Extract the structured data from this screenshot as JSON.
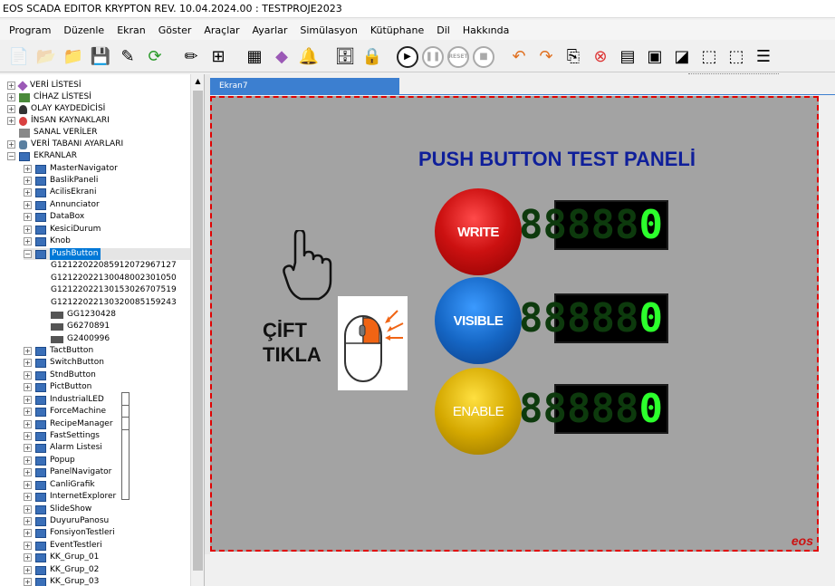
{
  "window": {
    "title": "EOS SCADA EDITOR KRYPTON REV. 10.04.2024.00 : TESTPROJE2023"
  },
  "menu": [
    "Program",
    "Düzenle",
    "Ekran",
    "Göster",
    "Araçlar",
    "Ayarlar",
    "Simülasyon",
    "Kütüphane",
    "Dil",
    "Hakkında"
  ],
  "toolbar": {
    "reset_label": "RESET",
    "icons": [
      "new-file-icon",
      "open-file-icon",
      "folder-icon",
      "save-icon",
      "save-as-icon",
      "refresh-icon",
      "edit-icon",
      "add-icon",
      "table-icon",
      "tag-icon",
      "bell-icon",
      "database-icon",
      "lock-icon",
      "play-icon",
      "pause-icon",
      "reset-icon",
      "stop-icon",
      "undo-icon",
      "redo-icon",
      "copy-icon",
      "delete-icon",
      "align-icon",
      "bring-front-icon",
      "send-back-icon",
      "group-icon",
      "ungroup-icon",
      "list-icon"
    ]
  },
  "tree": {
    "roots": [
      {
        "label": "VERİ LİSTESİ",
        "icon": "tag-icon"
      },
      {
        "label": "CİHAZ LİSTESİ",
        "icon": "device-icon"
      },
      {
        "label": "OLAY KAYDEDİCİSİ",
        "icon": "bell-icon"
      },
      {
        "label": "İNSAN KAYNAKLARI",
        "icon": "person-icon"
      },
      {
        "label": "SANAL VERİLER",
        "icon": "virtual-icon"
      },
      {
        "label": "VERİ TABANI AYARLARI",
        "icon": "database-icon"
      },
      {
        "label": "EKRANLAR",
        "icon": "monitor-icon"
      }
    ],
    "screens_before": [
      "MasterNavigator",
      "BaslikPaneli",
      "AcilisEkrani",
      "Annunciator",
      "DataBox",
      "KesiciDurum",
      "Knob"
    ],
    "selected": "PushButton",
    "children": [
      "G12122022085912072967127",
      "G12122022130048002301050",
      "G12122022130153026707519",
      "G12122022130320085159243",
      "GG1230428",
      "G6270891",
      "G2400996"
    ],
    "screens_after": [
      "TactButton",
      "SwitchButton",
      "StndButton",
      "PictButton",
      "IndustrialLED",
      "ForceMachine",
      "RecipeManager",
      "FastSettings",
      "Alarm Listesi",
      "Popup",
      "PanelNavigator",
      "CanliGrafik",
      "InternetExplorer",
      "SlideShow",
      "DuyuruPanosu",
      "FonsiyonTestleri",
      "EventTestleri",
      "KK_Grup_01",
      "KK_Grup_02",
      "KK_Grup_03"
    ]
  },
  "tab": {
    "label": "Ekran7"
  },
  "panel": {
    "title": "PUSH BUTTON TEST PANELİ",
    "buttons": {
      "write": "WRITE",
      "visible": "VISIBLE",
      "enable": "ENABLE"
    },
    "displays": [
      {
        "digits": [
          "8",
          "8",
          "8",
          "8",
          "8",
          "0"
        ],
        "lit": [
          false,
          false,
          false,
          false,
          false,
          true
        ]
      },
      {
        "digits": [
          "8",
          "8",
          "8",
          "8",
          "8",
          "0"
        ],
        "lit": [
          false,
          false,
          false,
          false,
          false,
          true
        ]
      },
      {
        "digits": [
          "8",
          "8",
          "8",
          "8",
          "8",
          "0"
        ],
        "lit": [
          false,
          false,
          false,
          false,
          false,
          true
        ]
      }
    ],
    "instruction_line1": "ÇİFT",
    "instruction_line2": "TIKLA",
    "logo": "eos"
  },
  "colors": {
    "title_blue": "#0f1f9a",
    "canvas_gray": "#a3a3a3",
    "border_red": "#e00000",
    "tab_blue": "#3c7fd0",
    "lcd_green": "#2cff2c"
  }
}
